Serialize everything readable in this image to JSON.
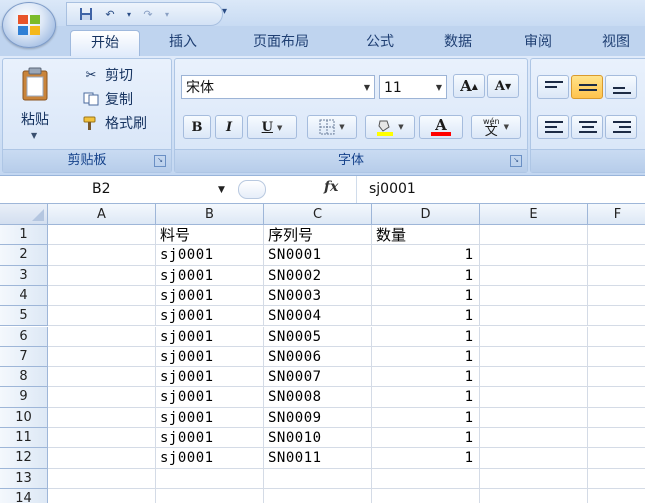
{
  "quick_access": {
    "save": "save-icon",
    "undo": "undo-icon",
    "redo": "redo-icon"
  },
  "tabs": [
    {
      "label": "开始",
      "active": true
    },
    {
      "label": "插入"
    },
    {
      "label": "页面布局"
    },
    {
      "label": "公式"
    },
    {
      "label": "数据"
    },
    {
      "label": "审阅"
    },
    {
      "label": "视图"
    }
  ],
  "clipboard": {
    "paste": "粘贴",
    "cut": "剪切",
    "copy": "复制",
    "format_painter": "格式刷",
    "group_label": "剪贴板"
  },
  "font": {
    "font_name": "宋体",
    "font_size": "11",
    "grow": "A",
    "shrink": "A",
    "bold": "B",
    "italic": "I",
    "underline": "U",
    "font_color_glyph": "A",
    "phonetic_glyph": "文",
    "phonetic_top": "wén",
    "group_label": "字体",
    "highlight_color": "#ffff00",
    "font_color": "#ff0000"
  },
  "formula_bar": {
    "name_box": "B2",
    "fx": "fx",
    "content": "sj0001"
  },
  "sheet": {
    "columns": [
      "A",
      "B",
      "C",
      "D",
      "E",
      "F"
    ],
    "row_numbers": [
      "1",
      "2",
      "3",
      "4",
      "5",
      "6",
      "7",
      "8",
      "9",
      "10",
      "11",
      "12",
      "13",
      "14"
    ],
    "header": [
      "",
      "料号",
      "序列号",
      "数量"
    ],
    "rows": [
      [
        "",
        "sj0001",
        "SN0001",
        "1"
      ],
      [
        "",
        "sj0001",
        "SN0002",
        "1"
      ],
      [
        "",
        "sj0001",
        "SN0003",
        "1"
      ],
      [
        "",
        "sj0001",
        "SN0004",
        "1"
      ],
      [
        "",
        "sj0001",
        "SN0005",
        "1"
      ],
      [
        "",
        "sj0001",
        "SN0006",
        "1"
      ],
      [
        "",
        "sj0001",
        "SN0007",
        "1"
      ],
      [
        "",
        "sj0001",
        "SN0008",
        "1"
      ],
      [
        "",
        "sj0001",
        "SN0009",
        "1"
      ],
      [
        "",
        "sj0001",
        "SN0010",
        "1"
      ],
      [
        "",
        "sj0001",
        "SN0011",
        "1"
      ]
    ]
  }
}
